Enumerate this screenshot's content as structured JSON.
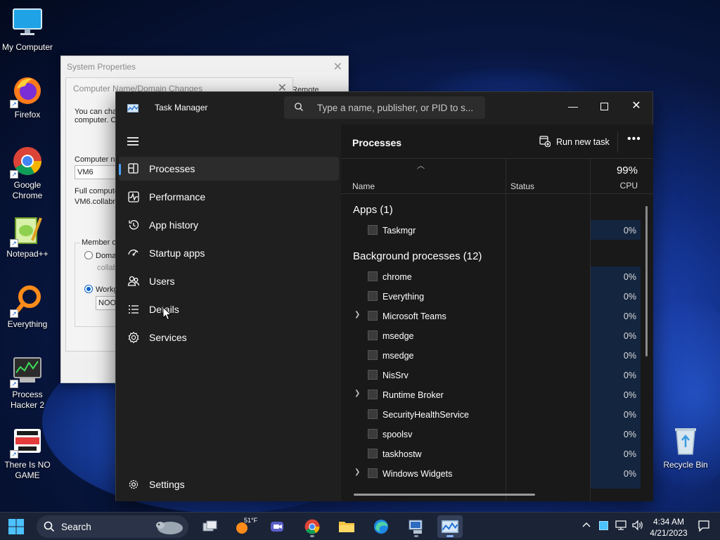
{
  "desktop": {
    "icons": [
      {
        "label": "My Computer",
        "icon": "monitor-icon"
      },
      {
        "label": "Firefox",
        "icon": "firefox-icon"
      },
      {
        "label": "Google Chrome",
        "icon": "chrome-icon"
      },
      {
        "label": "Notepad++",
        "icon": "notepad-plus-plus-icon"
      },
      {
        "label": "Everything",
        "icon": "everything-icon"
      },
      {
        "label": "Process Hacker 2",
        "icon": "process-hacker-icon"
      },
      {
        "label": "There Is NO GAME",
        "icon": "there-is-no-game-icon"
      },
      {
        "label": "Recycle Bin",
        "icon": "recycle-bin-icon"
      }
    ]
  },
  "system_properties": {
    "title": "System Properties",
    "remote_tab": "Remote",
    "dialog": {
      "title": "Computer Name/Domain Changes",
      "desc_line1": "You can cha",
      "desc_line2": "computer. Cl",
      "computer_name_label": "Computer na",
      "computer_name_value": "VM6",
      "full_name_label": "Full compute",
      "full_name_value": "VM6.collabn",
      "member_of_label": "Member of",
      "domain_label": "Doma",
      "domain_value": "collab",
      "workgroup_label": "Workg",
      "workgroup_value": "NOOO"
    }
  },
  "task_manager": {
    "title": "Task Manager",
    "search_placeholder": "Type a name, publisher, or PID to s...",
    "nav": [
      {
        "label": "Processes",
        "icon": "processes-icon",
        "active": true
      },
      {
        "label": "Performance",
        "icon": "performance-icon"
      },
      {
        "label": "App history",
        "icon": "app-history-icon"
      },
      {
        "label": "Startup apps",
        "icon": "startup-apps-icon"
      },
      {
        "label": "Users",
        "icon": "users-icon"
      },
      {
        "label": "Details",
        "icon": "details-icon"
      },
      {
        "label": "Services",
        "icon": "services-icon"
      }
    ],
    "settings_label": "Settings",
    "main": {
      "header_title": "Processes",
      "run_new_task": "Run new task",
      "columns": {
        "name": "Name",
        "status": "Status",
        "cpu": "CPU"
      },
      "cpu_total": "99%",
      "sections": [
        {
          "title": "Apps (1)",
          "rows": [
            {
              "name": "Taskmgr",
              "cpu": "0%",
              "expandable": false
            }
          ]
        },
        {
          "title": "Background processes (12)",
          "rows": [
            {
              "name": "chrome",
              "cpu": "0%",
              "expandable": false
            },
            {
              "name": "Everything",
              "cpu": "0%",
              "expandable": false
            },
            {
              "name": "Microsoft Teams",
              "cpu": "0%",
              "expandable": true
            },
            {
              "name": "msedge",
              "cpu": "0%",
              "expandable": false
            },
            {
              "name": "msedge",
              "cpu": "0%",
              "expandable": false
            },
            {
              "name": "NisSrv",
              "cpu": "0%",
              "expandable": false
            },
            {
              "name": "Runtime Broker",
              "cpu": "0%",
              "expandable": true
            },
            {
              "name": "SecurityHealthService",
              "cpu": "0%",
              "expandable": false
            },
            {
              "name": "spoolsv",
              "cpu": "0%",
              "expandable": false
            },
            {
              "name": "taskhostw",
              "cpu": "0%",
              "expandable": false
            },
            {
              "name": "Windows Widgets",
              "cpu": "0%",
              "expandable": true
            }
          ]
        }
      ]
    }
  },
  "taskbar": {
    "search_label": "Search",
    "weather": "51°F",
    "time": "4:34 AM",
    "date": "4/21/2023",
    "pinned": [
      "task-view-icon",
      "weather-icon",
      "teams-chat-icon",
      "chrome-icon",
      "file-explorer-icon",
      "edge-icon",
      "system-properties-icon",
      "task-manager-icon"
    ],
    "tray": [
      "chevron-up-icon",
      "tray-app-icon",
      "network-icon",
      "volume-icon",
      "notification-icon"
    ]
  }
}
